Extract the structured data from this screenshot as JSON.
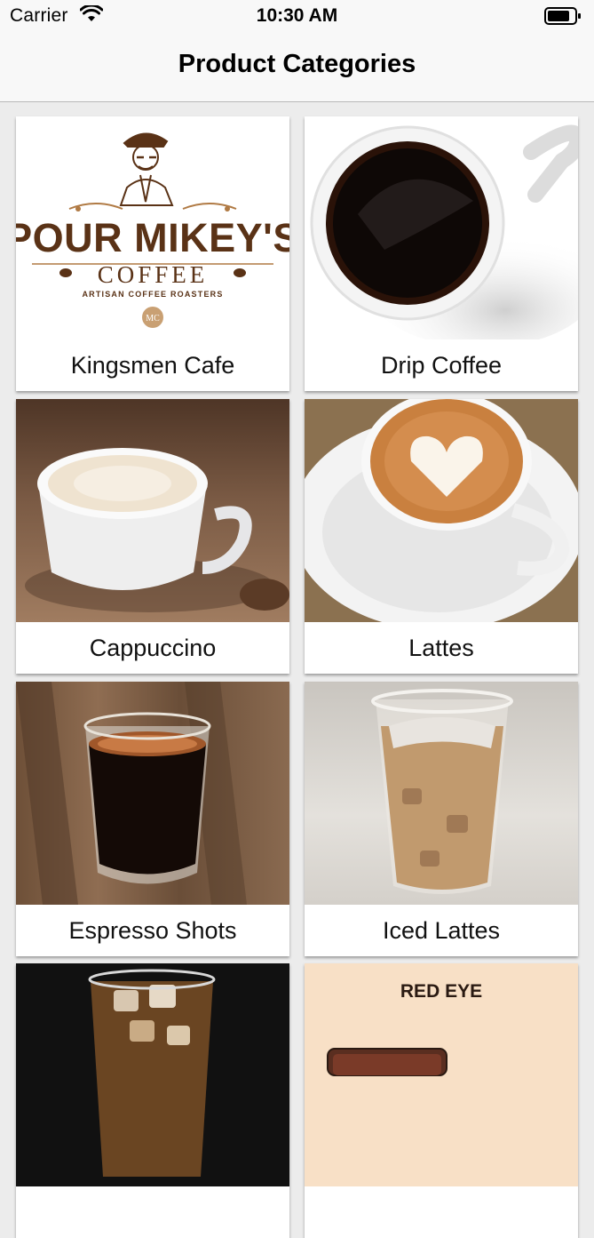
{
  "status_bar": {
    "carrier": "Carrier",
    "time": "10:30 AM",
    "icons": [
      "wifi-icon",
      "battery-icon"
    ]
  },
  "nav": {
    "title": "Product Categories"
  },
  "categories": [
    {
      "label": "Kingsmen Cafe",
      "image": "pour-mikeys-coffee-logo",
      "logo_text": {
        "top": "POUR MIKEY'S",
        "middle": "COFFEE",
        "bottom": "ARTISAN COFFEE ROASTERS",
        "seal": "MC"
      }
    },
    {
      "label": "Drip Coffee",
      "image": "black-coffee-cup-photo"
    },
    {
      "label": "Cappuccino",
      "image": "cappuccino-cup-photo"
    },
    {
      "label": "Lattes",
      "image": "latte-art-heart-photo"
    },
    {
      "label": "Espresso Shots",
      "image": "espresso-shot-glass-photo"
    },
    {
      "label": "Iced Lattes",
      "image": "iced-latte-cup-photo"
    },
    {
      "label": "",
      "image": "iced-coffee-glass-photo"
    },
    {
      "label": "",
      "image": "red-eye-menu-card",
      "image_text": "RED EYE"
    }
  ],
  "colors": {
    "background": "#ececec",
    "bar": "#f8f8f8",
    "logo_brown": "#5a3216",
    "red_eye_bg": "#f8e0c6"
  }
}
